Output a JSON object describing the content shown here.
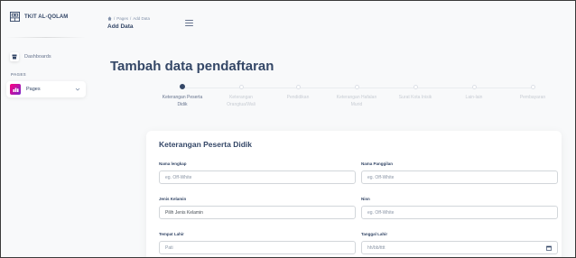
{
  "brand": {
    "name": "TKIT AL-QOLAM"
  },
  "sidebar": {
    "section_label": "PAGES",
    "items": [
      {
        "label": "Dashboards"
      },
      {
        "label": "Pages"
      }
    ]
  },
  "header": {
    "breadcrumb": [
      "Pages",
      "Add Data"
    ],
    "breadcrumb_sep": "/",
    "title": "Add Data"
  },
  "main": {
    "title": "Tambah data pendaftaran",
    "steps": [
      {
        "line1": "Keterangan Peserta",
        "line2": "Didik",
        "active": true
      },
      {
        "line1": "Keterangan",
        "line2": "Orangtua/Wali",
        "active": false
      },
      {
        "line1": "Pendidikan",
        "line2": "",
        "active": false
      },
      {
        "line1": "Keterangan Hafalan",
        "line2": "Murid",
        "active": false
      },
      {
        "line1": "Surat Kota Inisik",
        "line2": "",
        "active": false
      },
      {
        "line1": "Lain-lain",
        "line2": "",
        "active": false
      },
      {
        "line1": "Pembayaran",
        "line2": "",
        "active": false
      }
    ],
    "card": {
      "title": "Keterangan Peserta Didik",
      "fields": {
        "nama_lengkap": {
          "label": "Nama lengkap",
          "placeholder": "eg. Off-White"
        },
        "nama_panggilan": {
          "label": "Nama Panggilan",
          "placeholder": "eg. Off-White"
        },
        "jenis_kelamin": {
          "label": "Jenis Kelamin",
          "value": "Pilih Jenis Kelamin"
        },
        "nisn": {
          "label": "Nisn",
          "placeholder": "eg. Off-White"
        },
        "tempat_lahir": {
          "label": "Tempat Lahir",
          "placeholder": "Pati"
        },
        "tanggal_lahir": {
          "label": "Tanggal Lahir",
          "placeholder": "hh/bb/tttt"
        }
      }
    }
  },
  "colors": {
    "primary_text": "#344767",
    "muted_text": "#67748e",
    "accent_gradient_start": "#7928ca",
    "accent_gradient_end": "#ff0080",
    "background": "#f8f9fa"
  },
  "icons": {
    "brand": "building-icon",
    "dashboards": "shop-icon",
    "pages": "chart-icon",
    "menu": "hamburger-icon",
    "date": "calendar-icon"
  }
}
